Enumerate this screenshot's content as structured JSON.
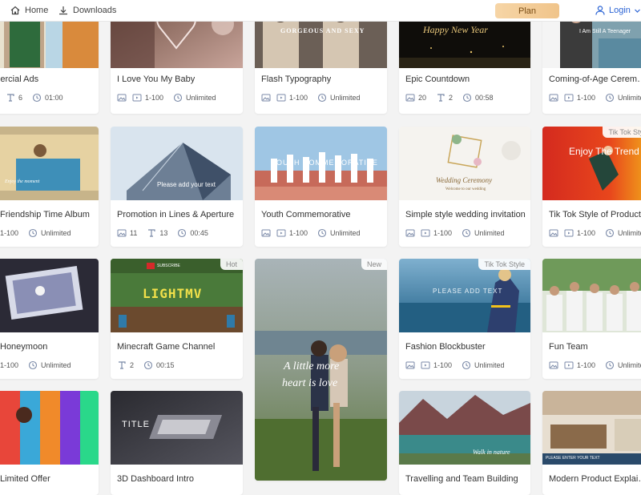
{
  "topbar": {
    "home_label": "Home",
    "downloads_label": "Downloads",
    "plan_label": "Plan",
    "login_label": "Login"
  },
  "colors": {
    "accent": "#2a63d4",
    "plan_bg": "#f0c48a"
  },
  "cards": {
    "c1": {
      "title": "Commercial Ads",
      "text_count": "6",
      "duration": "01:00",
      "overlay": ""
    },
    "c2": {
      "title": "I Love You My Baby",
      "photo_range": "1-100",
      "duration": "Unlimited",
      "overlay": ""
    },
    "c3": {
      "title": "Flash Typography",
      "photo_range": "1-100",
      "duration": "Unlimited",
      "overlay": "GORGEOUS AND SEXY"
    },
    "c4": {
      "title": "Epic Countdown",
      "image_count": "20",
      "text_count": "2",
      "duration": "00:58",
      "overlay": "Happy New Year"
    },
    "c5": {
      "title": "Coming-of-Age Ceremony",
      "photo_range": "1-100",
      "duration": "Unlimited",
      "overlay": "I Am Still A Teenager"
    },
    "c6": {
      "title": "Friendship Time Album",
      "photo_range": "1-100",
      "duration": "Unlimited",
      "overlay": "Enjoy the moment"
    },
    "c7": {
      "title": "Promotion in Lines & Aperture",
      "image_count": "11",
      "text_count": "13",
      "duration": "00:45",
      "overlay": "Please add your text"
    },
    "c8": {
      "title": "Youth Commemorative",
      "photo_range": "1-100",
      "duration": "Unlimited",
      "overlay": "YOUTH COMMEMORATIVE"
    },
    "c9": {
      "title": "Simple style wedding invitation",
      "photo_range": "1-100",
      "duration": "Unlimited",
      "overlay": "Wedding Ceremony",
      "overlay2": "Welcome to our wedding"
    },
    "c10": {
      "title": "Tik Tok Style of Product",
      "photo_range": "1-100",
      "duration": "Unlimited",
      "overlay": "Enjoy The Trend",
      "badge": "Tik Tok Style"
    },
    "c11": {
      "title": "Honeymoon",
      "photo_range": "1-100",
      "duration": "Unlimited",
      "overlay": ""
    },
    "c12": {
      "title": "Minecraft Game Channel",
      "text_count": "2",
      "duration": "00:15",
      "overlay": "LIGHTMV",
      "overlay2": "SUBSCRIBE",
      "badge": "Hot"
    },
    "c13": {
      "title": "",
      "overlay": "A little more",
      "overlay2": "heart is love",
      "badge": "New"
    },
    "c14": {
      "title": "Fashion Blockbuster",
      "photo_range": "1-100",
      "duration": "Unlimited",
      "overlay": "PLEASE ADD TEXT",
      "badge": "Tik Tok Style"
    },
    "c15": {
      "title": "Fun Team",
      "photo_range": "1-100",
      "duration": "Unlimited",
      "overlay": ""
    },
    "c16": {
      "title": "Limited Offer",
      "overlay": ""
    },
    "c17": {
      "title": "3D Dashboard Intro",
      "overlay": "TITLE"
    },
    "c18": {
      "title": "Travelling and Team Building",
      "overlay": "Walk in nature"
    },
    "c19": {
      "title": "Modern Product Explainer",
      "overlay": "PLEASE ENTER YOUR TEXT"
    }
  }
}
